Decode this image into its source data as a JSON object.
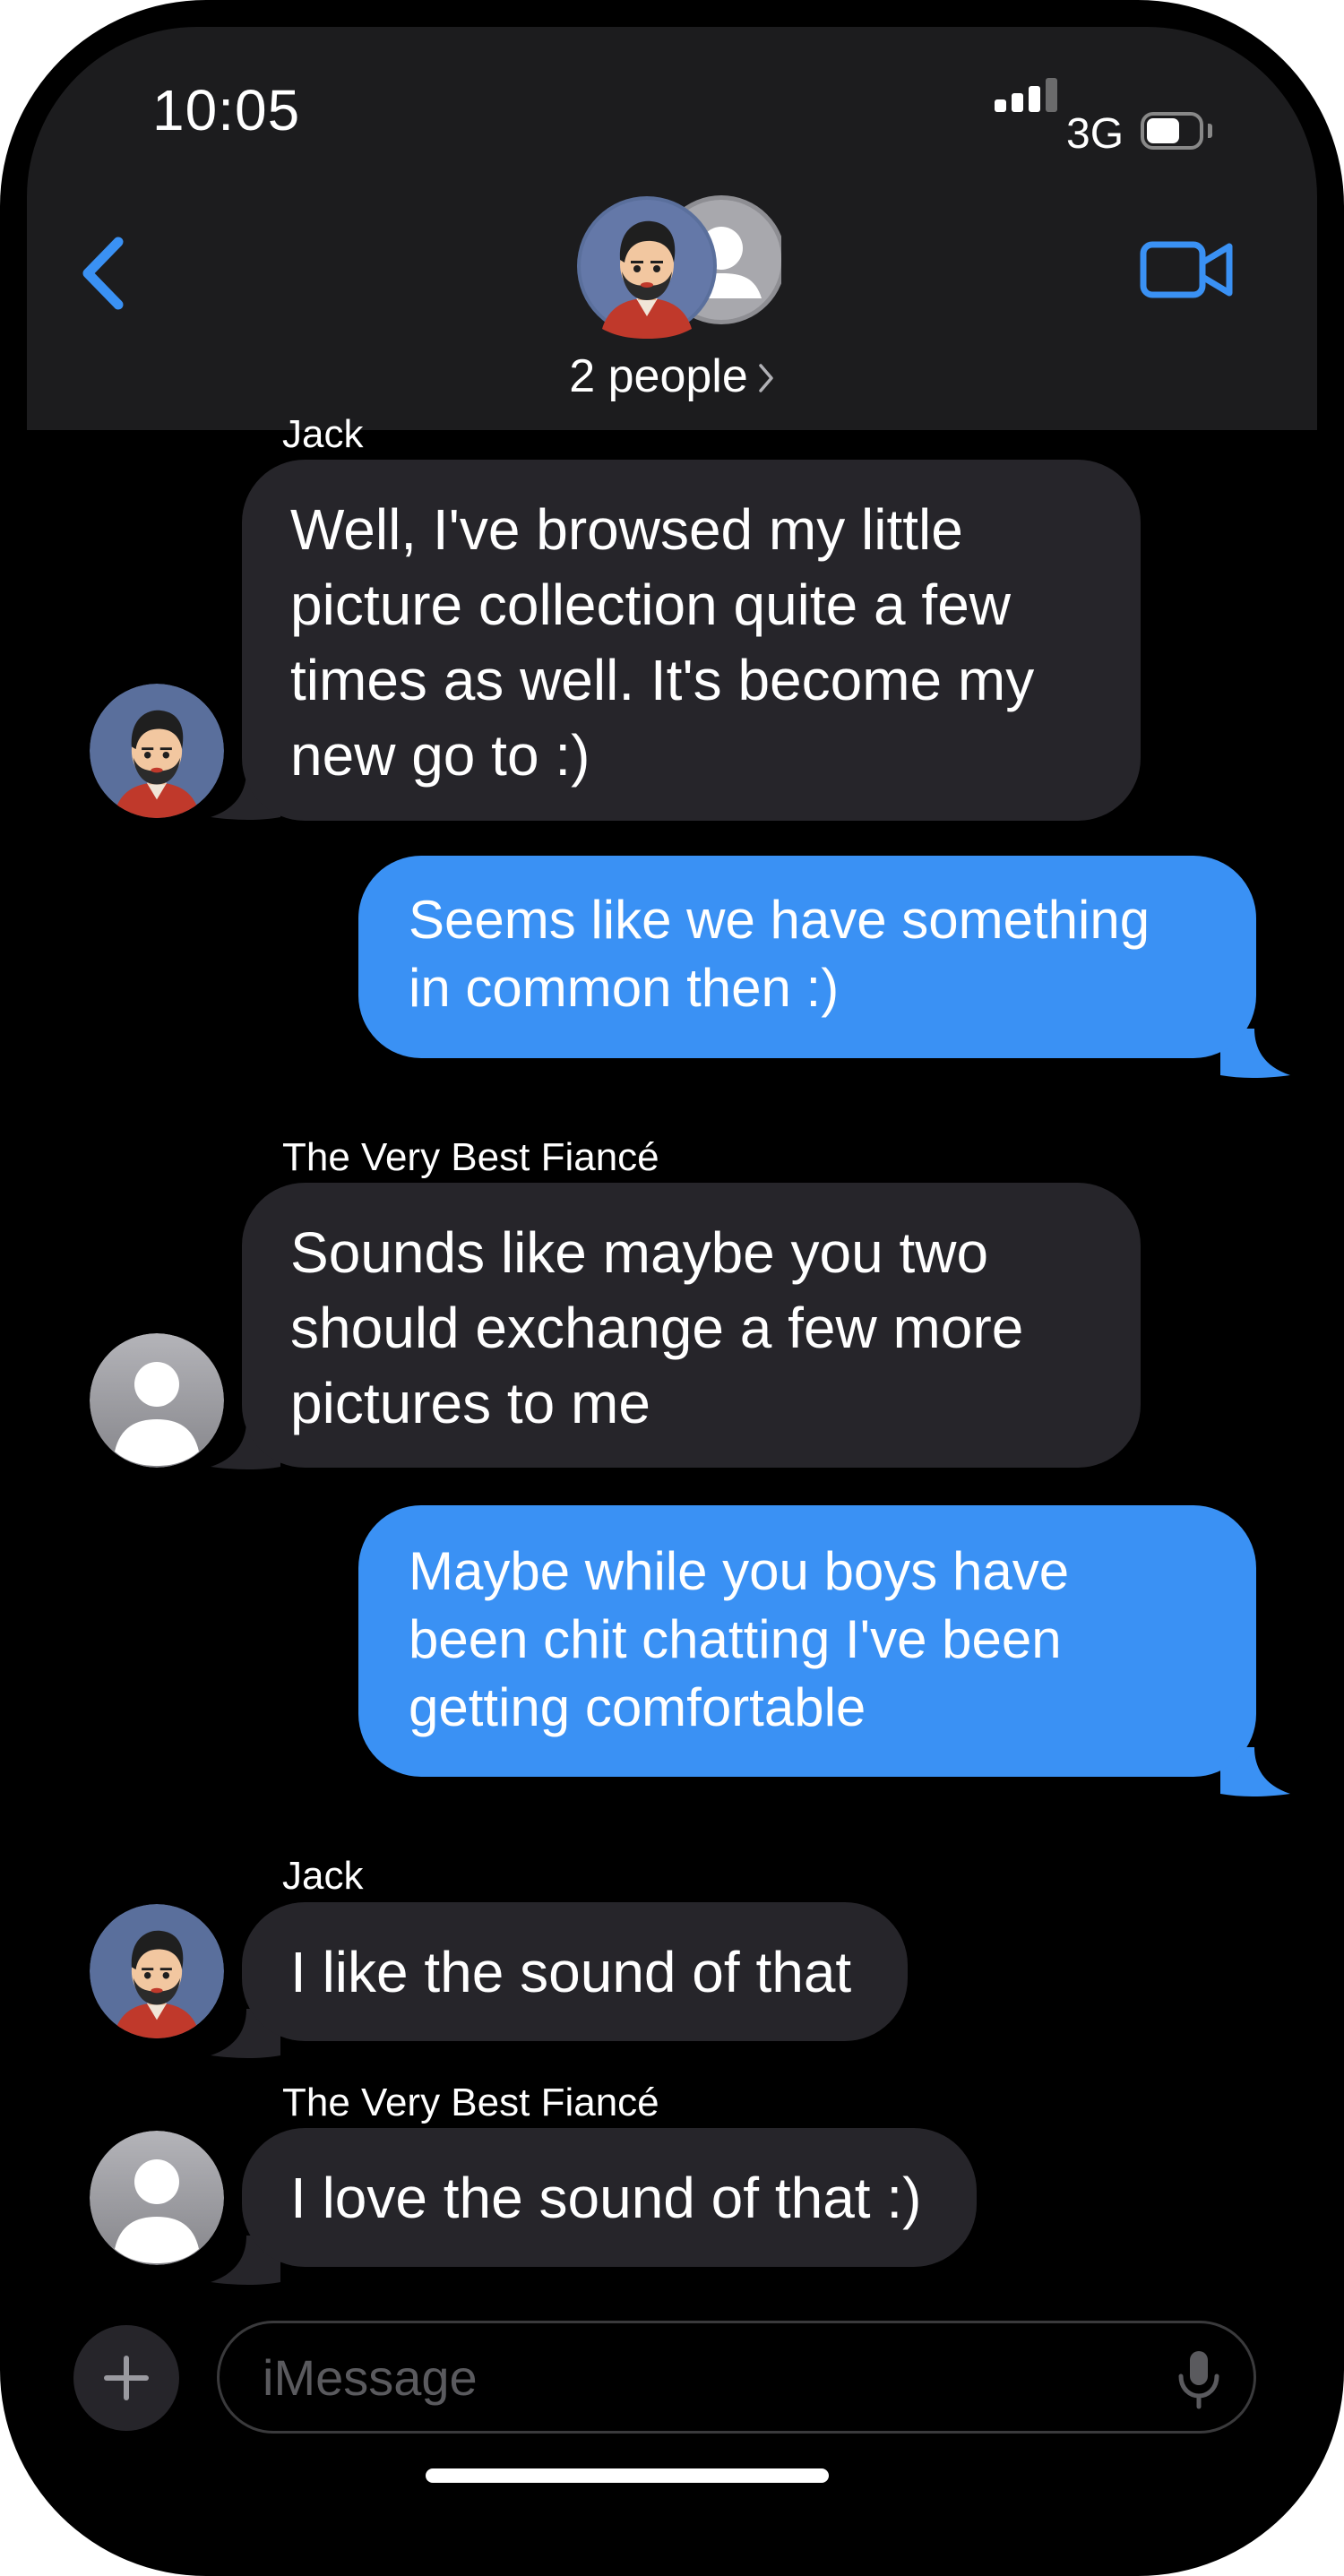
{
  "status_bar": {
    "time": "10:05",
    "network": "3G"
  },
  "header": {
    "group_label": "2 people"
  },
  "messages": [
    {
      "direction": "incoming",
      "sender": "Jack",
      "text": "Well, I've browsed my little\npicture collection quite a few\ntimes as well.  It's become my\nnew go to :)"
    },
    {
      "direction": "outgoing",
      "text": "Seems like we have something\nin common then :)"
    },
    {
      "direction": "incoming",
      "sender": "The Very Best Fiancé",
      "text": "Sounds like maybe you two\nshould exchange a few more\npictures to me"
    },
    {
      "direction": "outgoing",
      "text": "Maybe while you boys have\nbeen chit chatting I've been\ngetting comfortable"
    },
    {
      "direction": "incoming",
      "sender": "Jack",
      "text": "I like the sound of that"
    },
    {
      "direction": "incoming",
      "sender": "The Very Best Fiancé",
      "text": "I love the sound of that :)"
    }
  ],
  "composer": {
    "placeholder": "iMessage"
  },
  "icons": {
    "back": "chevron-left-icon",
    "video": "video-camera-icon",
    "group_chevron": "chevron-right-icon",
    "plus": "plus-icon",
    "mic": "microphone-icon"
  },
  "colors": {
    "accent": "#3a91f4",
    "outgoing_bubble": "#3a91f4",
    "incoming_bubble": "#26252a",
    "header_background": "#1c1c1e",
    "background": "#000000"
  }
}
